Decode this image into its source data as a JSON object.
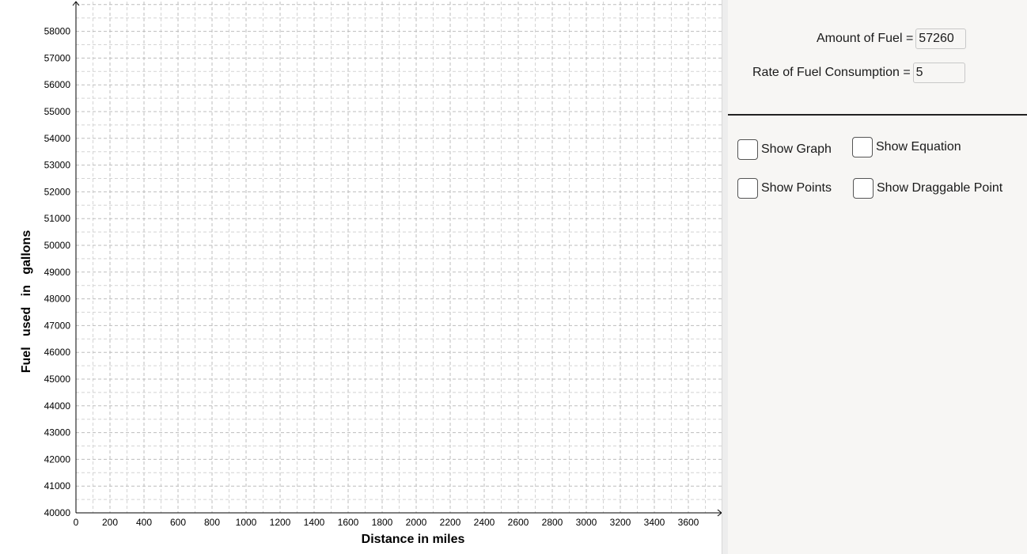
{
  "graph": {
    "x_axis_title": "Distance in miles",
    "y_axis_title": "Fuel   used   in   gallons",
    "x_ticks": [
      "0",
      "200",
      "400",
      "600",
      "800",
      "1000",
      "1200",
      "1400",
      "1600",
      "1800",
      "2000",
      "2200",
      "2400",
      "2600",
      "2800",
      "3000",
      "3200",
      "3400",
      "3600"
    ],
    "y_ticks": [
      "40000",
      "41000",
      "42000",
      "43000",
      "44000",
      "45000",
      "46000",
      "47000",
      "48000",
      "49000",
      "50000",
      "51000",
      "52000",
      "53000",
      "54000",
      "55000",
      "56000",
      "57000",
      "58000"
    ]
  },
  "panel": {
    "amount_label": "Amount of Fuel =",
    "amount_value": "57260",
    "rate_label": "Rate of Fuel Consumption =",
    "rate_value": "5",
    "checkboxes": {
      "show_graph": "Show Graph",
      "show_equation": "Show Equation",
      "show_points": "Show Points",
      "show_draggable_point": "Show Draggable Point"
    }
  }
}
